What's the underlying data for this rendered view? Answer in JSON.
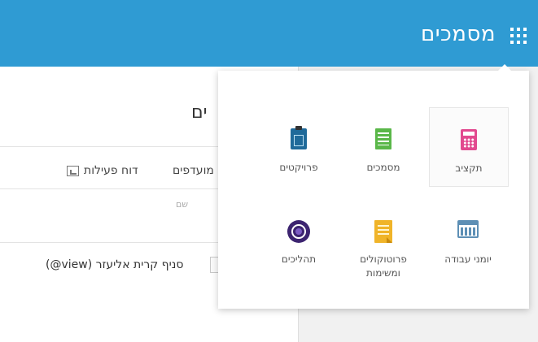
{
  "app": {
    "title": "מסמכים"
  },
  "page": {
    "title": "ים",
    "report_link": "דוח פעילות",
    "favorites_link": "מועדפים",
    "column_header": "שם",
    "row_branch": "סניף קרית אליעזר (view@)"
  },
  "apps_menu": {
    "tiles": [
      {
        "label": "תקציב",
        "icon": "calculator-icon",
        "selected": true
      },
      {
        "label": "מסמכים",
        "icon": "spreadsheet-icon"
      },
      {
        "label": "פרויקטים",
        "icon": "clipboard-icon"
      },
      {
        "label": "יומני עבודה",
        "icon": "calendar-icon"
      },
      {
        "label": "פרוטוקולים ומשימות",
        "icon": "notes-icon"
      },
      {
        "label": "תהליכים",
        "icon": "process-icon"
      }
    ]
  },
  "colors": {
    "header": "#2f9bd3"
  }
}
